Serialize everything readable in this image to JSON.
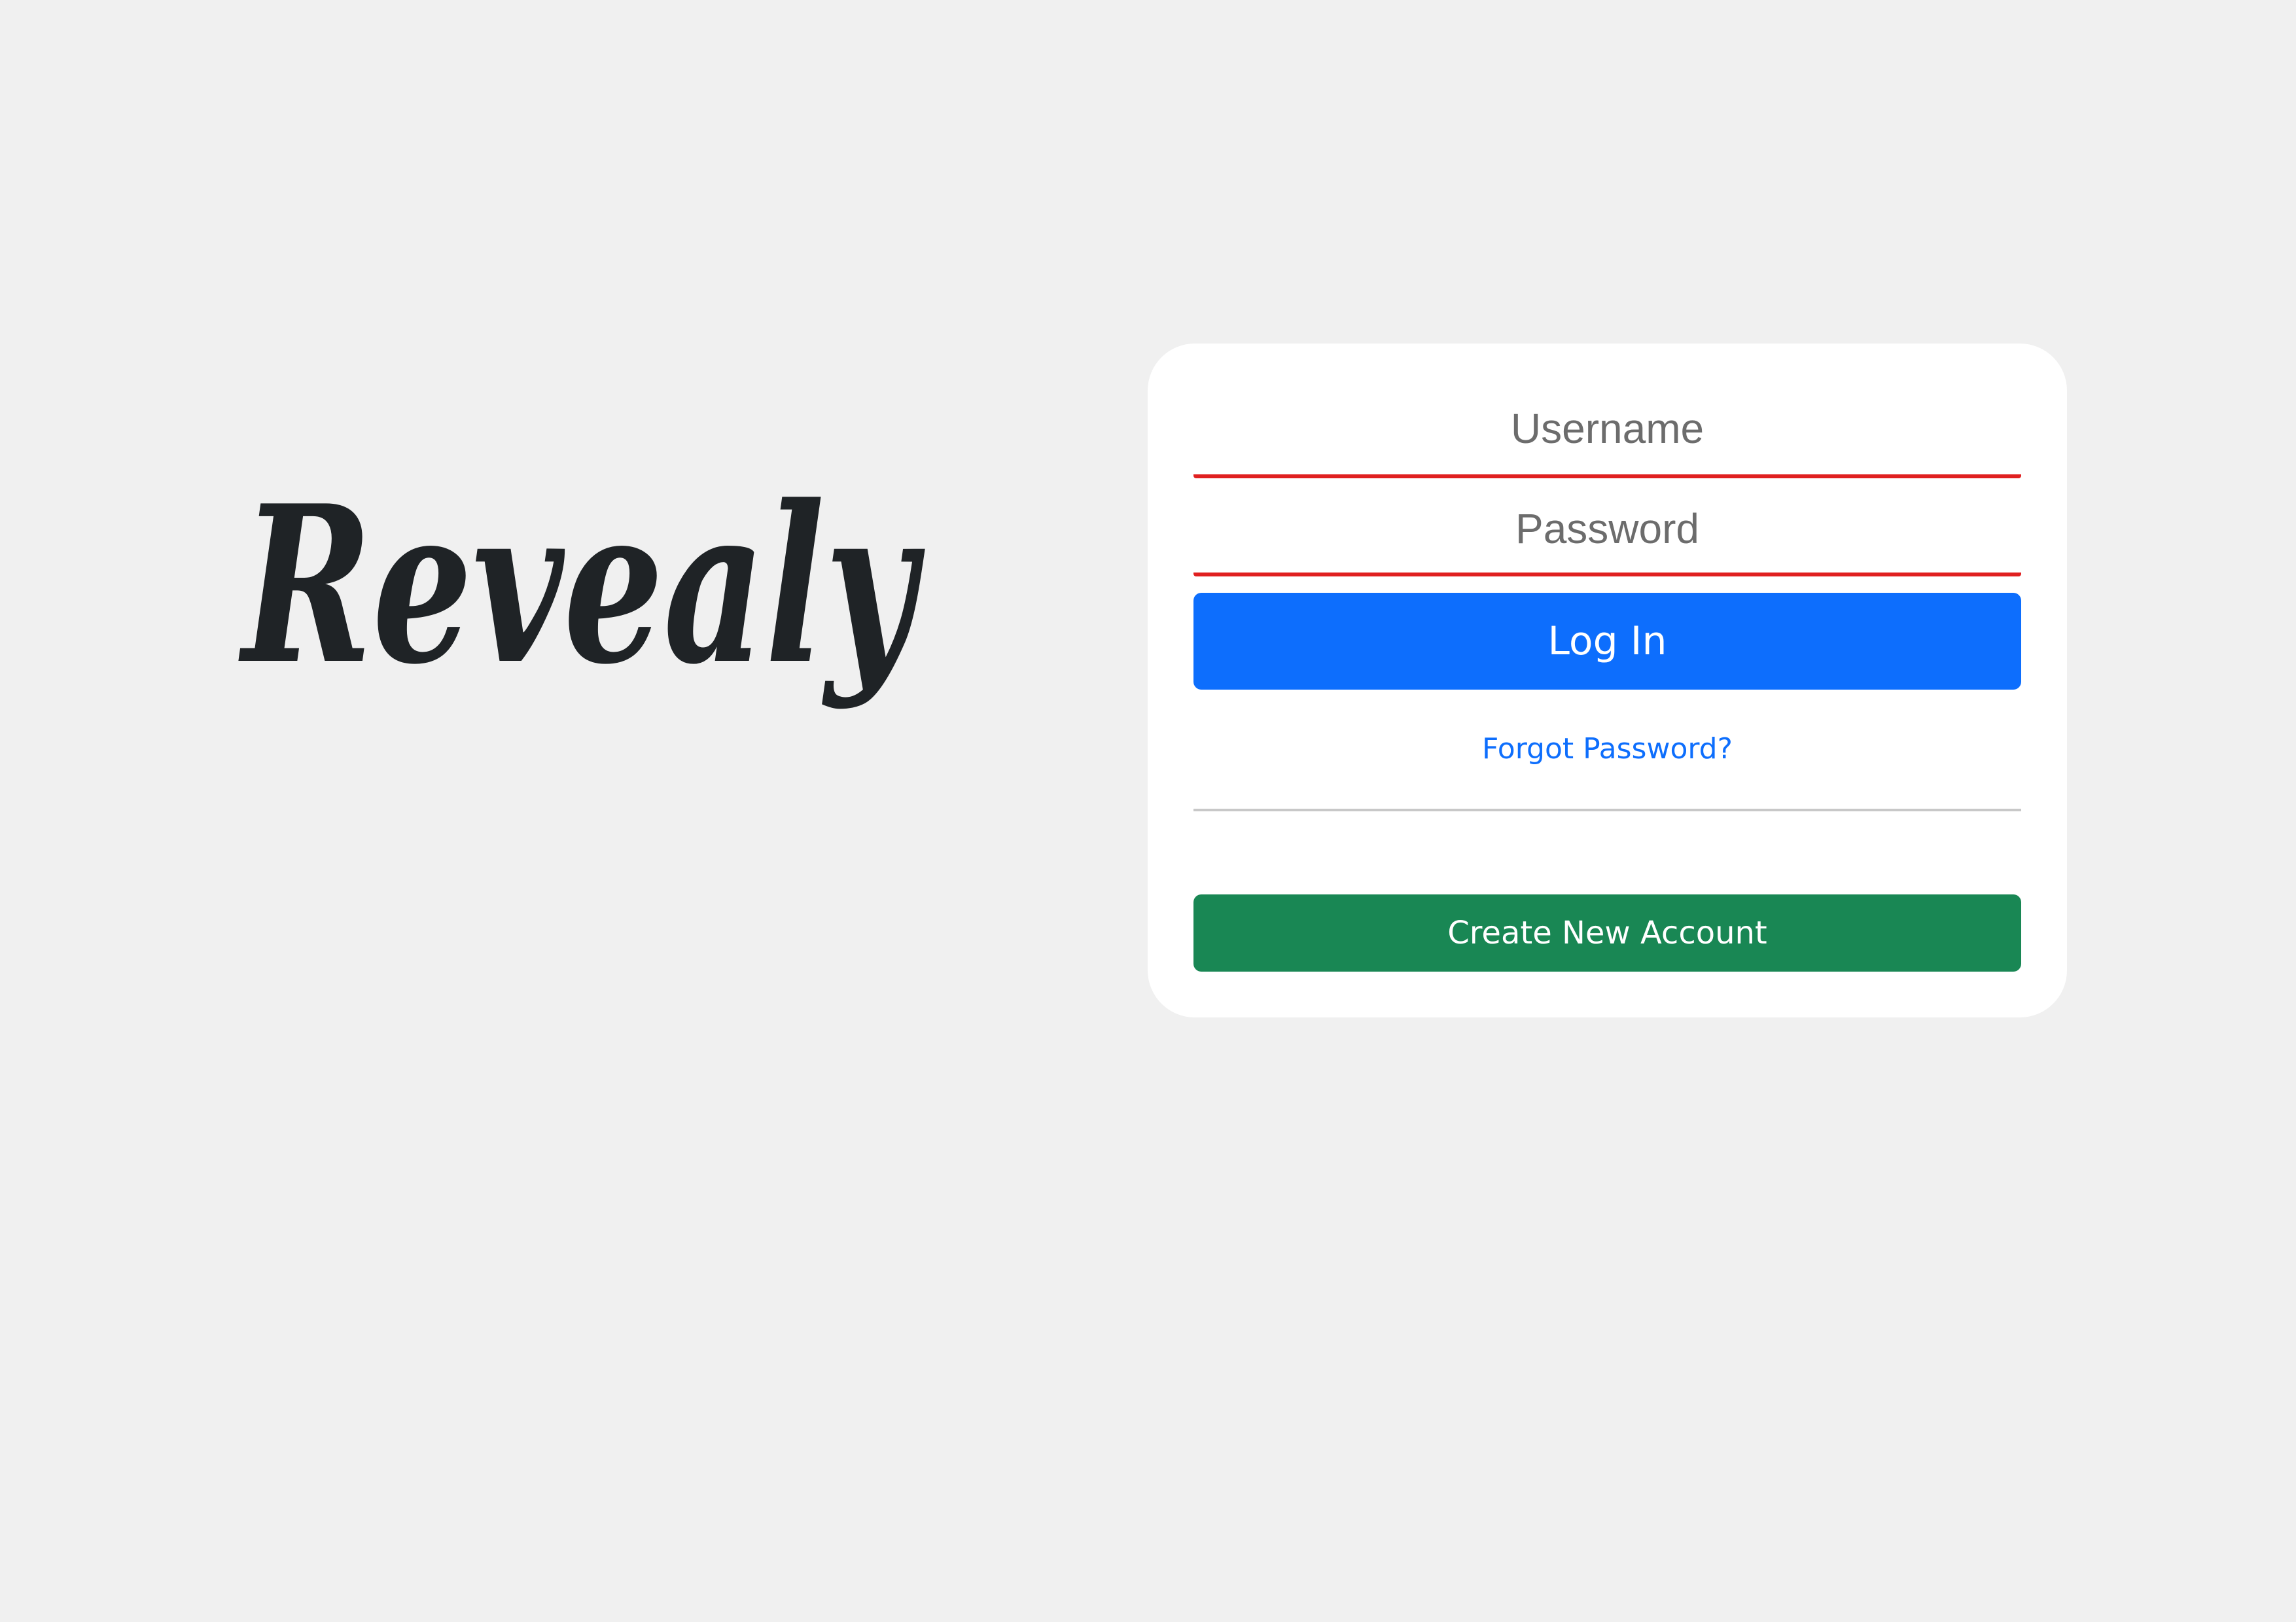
{
  "brand": {
    "logo_text": "Revealy"
  },
  "login_form": {
    "username_placeholder": "Username",
    "username_value": "",
    "password_placeholder": "Password",
    "password_value": "",
    "login_label": "Log In",
    "forgot_label": "Forgot Password?",
    "create_label": "Create New Account"
  },
  "colors": {
    "background": "#f0f0f0",
    "card": "#ffffff",
    "primary": "#0d6efd",
    "success": "#198754",
    "error_underline": "#e02020",
    "logo": "#1f2326"
  },
  "icons": []
}
